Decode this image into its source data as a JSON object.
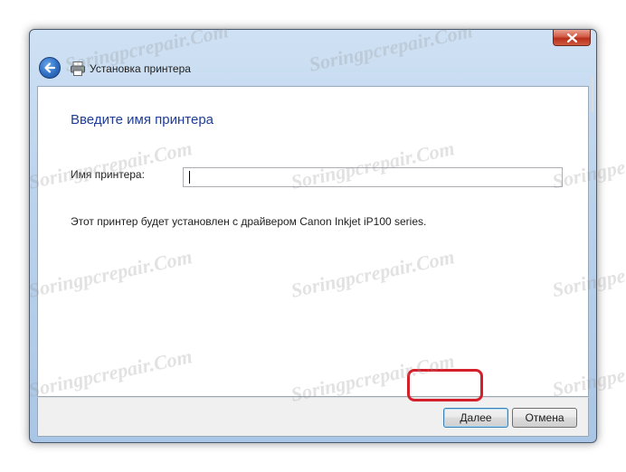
{
  "window": {
    "title": "Установка принтера"
  },
  "content": {
    "heading": "Введите имя принтера",
    "printer_name_label": "Имя принтера:",
    "printer_name_value": "",
    "info_text": "Этот принтер будет установлен с драйвером Canon Inkjet iP100 series."
  },
  "footer": {
    "next_label": "Далее",
    "cancel_label": "Отмена"
  },
  "watermark": {
    "text": "Soringpcrepair.Com",
    "partial_text": "Soringpe"
  },
  "icons": {
    "close": "close-icon",
    "back": "back-arrow-icon",
    "printer": "printer-icon"
  },
  "colors": {
    "heading": "#1f3d96",
    "highlight": "#d4202a",
    "close_button": "#c7432f"
  }
}
